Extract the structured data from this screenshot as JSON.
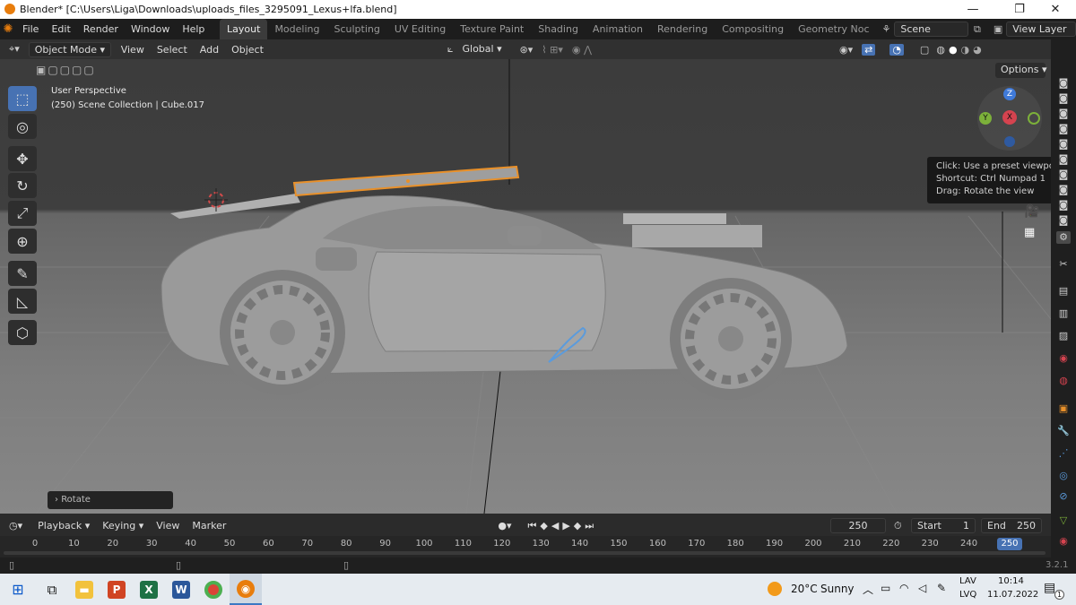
{
  "window": {
    "title": "Blender* [C:\\Users\\Liga\\Downloads\\uploads_files_3295091_Lexus+lfa.blend]",
    "minimize": "—",
    "restore": "❐",
    "close": "✕"
  },
  "menubar": {
    "items": [
      "File",
      "Edit",
      "Render",
      "Window",
      "Help"
    ],
    "workspaces": [
      "Layout",
      "Modeling",
      "Sculpting",
      "UV Editing",
      "Texture Paint",
      "Shading",
      "Animation",
      "Rendering",
      "Compositing",
      "Geometry Noc"
    ],
    "active_workspace": "Layout",
    "scene": "Scene",
    "view_layer": "View Layer"
  },
  "viewport_header": {
    "mode": "Object Mode",
    "menus": [
      "View",
      "Select",
      "Add",
      "Object"
    ],
    "orientation": "Global",
    "options_label": "Options"
  },
  "viewport": {
    "perspective": "User Perspective",
    "collection": "(250) Scene Collection | Cube.017",
    "last_operator": "Rotate"
  },
  "tooltip": {
    "line1": "Click: Use a preset viewpoint",
    "line2": "Shortcut: Ctrl Numpad 1",
    "line3": "Drag: Rotate the view"
  },
  "gizmo": {
    "z": "Z",
    "y": "Y",
    "x": "X"
  },
  "timeline": {
    "menus": [
      "Playback",
      "Keying",
      "View",
      "Marker"
    ],
    "current_frame": "250",
    "start_label": "Start",
    "start_value": "1",
    "end_label": "End",
    "end_value": "250",
    "ticks": [
      "0",
      "10",
      "20",
      "30",
      "40",
      "50",
      "60",
      "70",
      "80",
      "90",
      "100",
      "110",
      "120",
      "130",
      "140",
      "150",
      "160",
      "170",
      "180",
      "190",
      "200",
      "210",
      "220",
      "230",
      "240"
    ],
    "playhead_label": "250"
  },
  "statusbar": {
    "version": "3.2.1"
  },
  "taskbar": {
    "weather_temp": "20°C",
    "weather_text": "Sunny",
    "lang_top": "LAV",
    "lang_bottom": "LVQ",
    "time": "10:14",
    "date": "11.07.2022",
    "notifications": "1"
  },
  "colors": {
    "accent": "#4772b3",
    "selection": "#e8902a",
    "playhead": "#4772b3",
    "gizmo_x": "#d5434f",
    "gizmo_y": "#7cb03a",
    "gizmo_z": "#3f7ad9"
  }
}
